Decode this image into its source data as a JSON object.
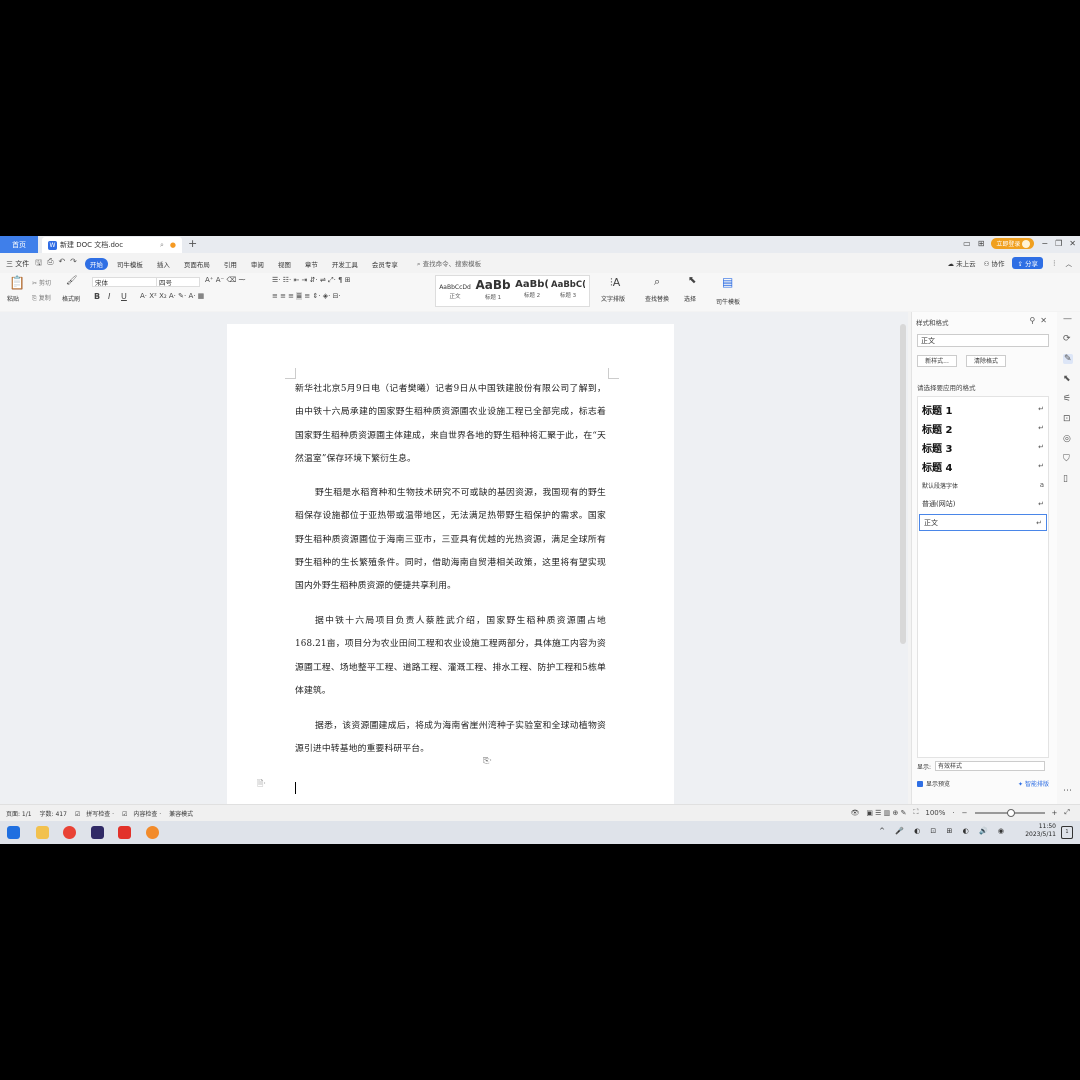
{
  "titlebar": {
    "home_tab": "首页",
    "doc_tab": "新建 DOC 文档.doc",
    "login_button": "立即登录"
  },
  "menu": {
    "file": "三 文件",
    "tabs": [
      "开始",
      "司牛模板",
      "插入",
      "页面布局",
      "引用",
      "审阅",
      "视图",
      "章节",
      "开发工具",
      "会员专享"
    ],
    "active_tab": "开始",
    "command_search": "查找命令、搜索模板",
    "cloud": "未上云",
    "collab": "协作",
    "share": "分享"
  },
  "ribbon": {
    "paste": "粘贴",
    "cut": "剪切",
    "copy": "复制",
    "format_painter": "格式刷",
    "font_name": "宋体",
    "font_size": "四号",
    "styles": [
      {
        "preview": "AaBbCcDd",
        "label": "正文"
      },
      {
        "preview": "AaBb",
        "label": "标题 1"
      },
      {
        "preview": "AaBb(",
        "label": "标题 2"
      },
      {
        "preview": "AaBbC(",
        "label": "标题 3"
      }
    ],
    "text_layout": "文字排版",
    "find_replace": "查找替换",
    "select": "选择",
    "sinui_template": "司牛模板"
  },
  "document": {
    "paragraphs": [
      "新华社北京5月9日电（记者樊曦）记者9日从中国铁建股份有限公司了解到，由中铁十六局承建的国家野生稻种质资源圃农业设施工程已全部完成，标志着国家野生稻种质资源圃主体建成，来自世界各地的野生稻种将汇聚于此，在“天然温室”保存环境下繁衍生息。",
      "野生稻是水稻育种和生物技术研究不可或缺的基因资源，我国现有的野生稻保存设施都位于亚热带或温带地区，无法满足热带野生稻保护的需求。国家野生稻种质资源圃位于海南三亚市，三亚具有优越的光热资源，满足全球所有野生稻种的生长繁殖条件。同时，借助海南自贸港相关政策，这里将有望实现国内外野生稻种质资源的便捷共享利用。",
      "据中铁十六局项目负责人蔡胜武介绍，国家野生稻种质资源圃占地168.21亩，项目分为农业田间工程和农业设施工程两部分，具体施工内容为资源圃工程、场地整平工程、道路工程、灌溉工程、排水工程、防护工程和5栋单体建筑。",
      "据悉，该资源圃建成后，将成为海南省崖州湾种子实验室和全球动植物资源引进中转基地的重要科研平台。"
    ]
  },
  "panel": {
    "title": "样式和格式",
    "current_style": "正文",
    "new_style": "新样式...",
    "clear_format": "清除格式",
    "hint": "请选择要应用的格式",
    "styles": [
      {
        "name": "标题  1",
        "kind": "heading"
      },
      {
        "name": "标题  2",
        "kind": "heading"
      },
      {
        "name": "标题  3",
        "kind": "heading"
      },
      {
        "name": "标题  4",
        "kind": "heading"
      },
      {
        "name": "默认段落字体",
        "kind": "small"
      },
      {
        "name": "普通(网站)",
        "kind": "normal"
      },
      {
        "name": "正文",
        "kind": "normal",
        "selected": true
      }
    ],
    "show_label": "显示:",
    "show_value": "有效样式",
    "show_preview": "显示预览",
    "smart_layout": "智能排版"
  },
  "status": {
    "page": "页面: 1/1",
    "words": "字数: 417",
    "spell": "拼写检查",
    "content_check": "内容检查",
    "compat": "兼容模式",
    "zoom": "100%",
    "zoom_fraction": 0.5
  },
  "taskbar": {
    "time": "11:50",
    "date": "2023/5/11"
  },
  "colors": {
    "accent": "#2f6fe4",
    "login": "#f0a020"
  }
}
